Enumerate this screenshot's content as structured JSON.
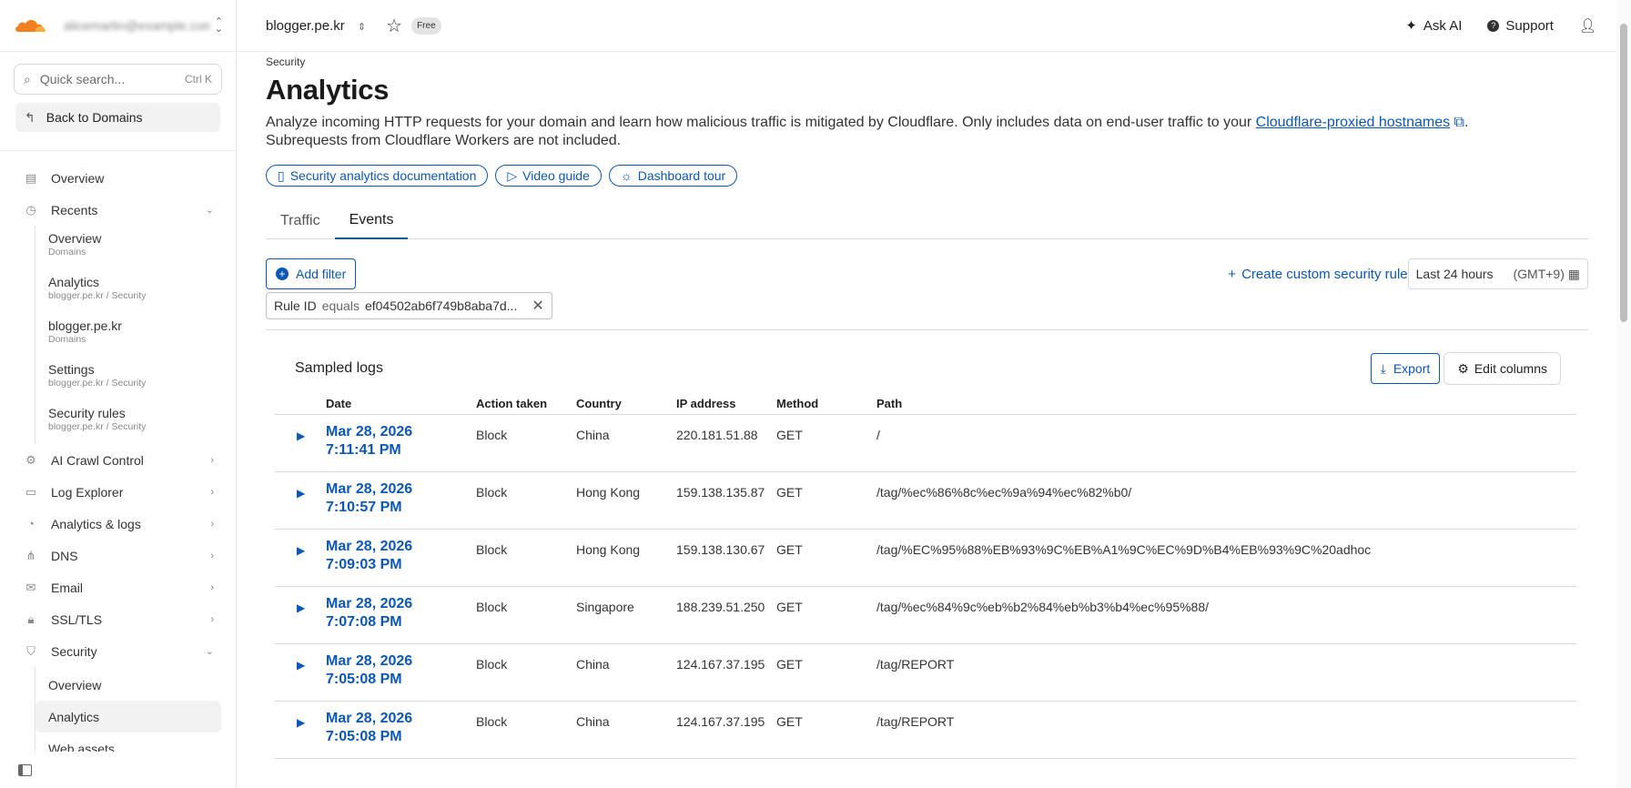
{
  "header": {
    "account": "alicemartin@example.com",
    "domain": "blogger.pe.kr",
    "plan_badge": "Free",
    "ask_ai": "Ask AI",
    "support": "Support"
  },
  "sidebar": {
    "search_placeholder": "Quick search...",
    "search_shortcut": "Ctrl K",
    "back_label": "Back to Domains",
    "overview": "Overview",
    "recents": "Recents",
    "recent_items": [
      {
        "title": "Overview",
        "sub": "Domains"
      },
      {
        "title": "Analytics",
        "sub": "blogger.pe.kr  /  Security"
      },
      {
        "title": "blogger.pe.kr",
        "sub": "Domains"
      },
      {
        "title": "Settings",
        "sub": "blogger.pe.kr  /  Security"
      },
      {
        "title": "Security rules",
        "sub": "blogger.pe.kr  /  Security"
      }
    ],
    "nav": [
      "AI Crawl Control",
      "Log Explorer",
      "Analytics & logs",
      "DNS",
      "Email",
      "SSL/TLS"
    ],
    "security": "Security",
    "security_items": [
      "Overview",
      "Analytics",
      "Web assets"
    ]
  },
  "page": {
    "breadcrumb": "Security",
    "title": "Analytics",
    "description_1": "Analyze incoming HTTP requests for your domain and learn how malicious traffic is mitigated by Cloudflare. Only includes data on end-user traffic to your ",
    "description_link": "Cloudflare-proxied hostnames",
    "description_2": ".",
    "description_3": "Subrequests from Cloudflare Workers are not included.",
    "pills": [
      "Security analytics documentation",
      "Video guide",
      "Dashboard tour"
    ],
    "tabs": [
      "Traffic",
      "Events"
    ],
    "add_filter": "Add filter",
    "create_rule": "Create custom security rule",
    "time_range": "Last 24 hours",
    "timezone": "(GMT+9)",
    "filter_chip": {
      "field": "Rule ID",
      "op": "equals",
      "value": "ef04502ab6f749b8aba7d..."
    }
  },
  "logs": {
    "title": "Sampled logs",
    "export": "Export",
    "edit_columns": "Edit columns",
    "columns": [
      "Date",
      "Action taken",
      "Country",
      "IP address",
      "Method",
      "Path"
    ],
    "rows": [
      {
        "date": "Mar 28, 2026",
        "time": "7:11:41 PM",
        "action": "Block",
        "country": "China",
        "ip": "220.181.51.88",
        "method": "GET",
        "path": "/"
      },
      {
        "date": "Mar 28, 2026",
        "time": "7:10:57 PM",
        "action": "Block",
        "country": "Hong Kong",
        "ip": "159.138.135.87",
        "method": "GET",
        "path": "/tag/%ec%86%8c%ec%9a%94%ec%82%b0/"
      },
      {
        "date": "Mar 28, 2026",
        "time": "7:09:03 PM",
        "action": "Block",
        "country": "Hong Kong",
        "ip": "159.138.130.67",
        "method": "GET",
        "path": "/tag/%EC%95%88%EB%93%9C%EB%A1%9C%EC%9D%B4%EB%93%9C%20adhoc"
      },
      {
        "date": "Mar 28, 2026",
        "time": "7:07:08 PM",
        "action": "Block",
        "country": "Singapore",
        "ip": "188.239.51.250",
        "method": "GET",
        "path": "/tag/%ec%84%9c%eb%b2%84%eb%b3%b4%ec%95%88/"
      },
      {
        "date": "Mar 28, 2026",
        "time": "7:05:08 PM",
        "action": "Block",
        "country": "China",
        "ip": "124.167.37.195",
        "method": "GET",
        "path": "/tag/REPORT"
      },
      {
        "date": "Mar 28, 2026",
        "time": "7:05:08 PM",
        "action": "Block",
        "country": "China",
        "ip": "124.167.37.195",
        "method": "GET",
        "path": "/tag/REPORT"
      }
    ]
  },
  "colors": {
    "accent": "#0b57b5",
    "brand": "#f38020"
  }
}
